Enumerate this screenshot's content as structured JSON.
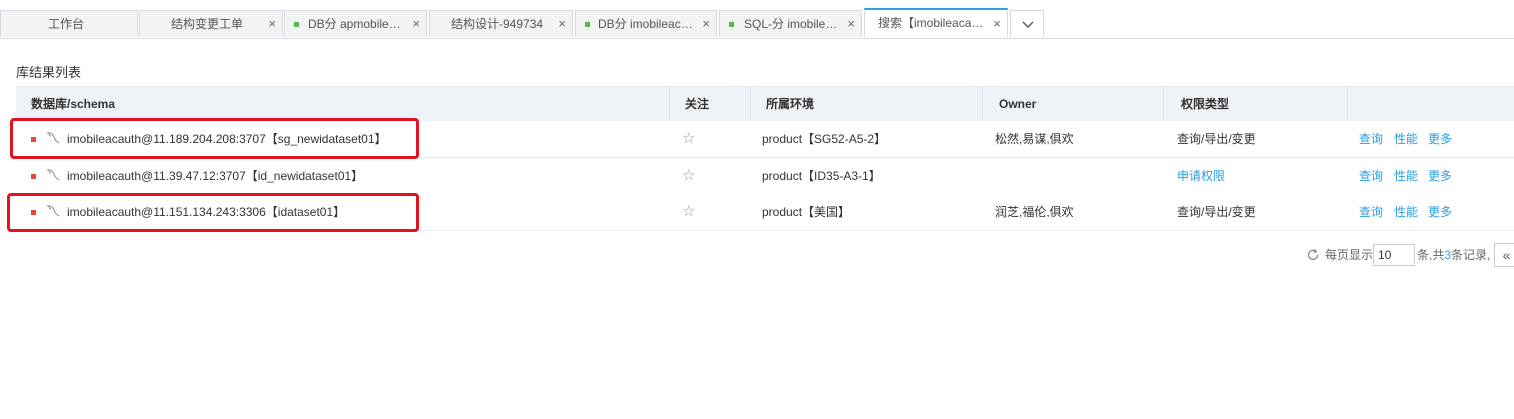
{
  "tabs": [
    {
      "label": "工作台",
      "closable": false,
      "dot": false
    },
    {
      "label": "结构变更工单",
      "closable": true,
      "dot": false
    },
    {
      "label": "DB分 apmobile…",
      "closable": true,
      "dot": true
    },
    {
      "label": "结构设计-949734",
      "closable": true,
      "dot": false
    },
    {
      "label": "DB分 imobileac…",
      "closable": true,
      "dot": true
    },
    {
      "label": "SQL-分 imobile…",
      "closable": true,
      "dot": true
    },
    {
      "label": "搜索【imobileaca…",
      "closable": true,
      "dot": false,
      "active": true
    }
  ],
  "tab_close_glyph": "×",
  "section_title": "库结果列表",
  "table": {
    "headers": {
      "db": "数据库/schema",
      "follow": "关注",
      "env": "所属环境",
      "owner": "Owner",
      "perm": "权限类型"
    },
    "rows": [
      {
        "db": "imobileacauth@11.189.204.208:3707【sg_newidataset01】",
        "env": "product【SG52-A5-2】",
        "owner": "松然,易谋,俱欢",
        "perm": "查询/导出/变更",
        "perm_is_link": false
      },
      {
        "db": "imobileacauth@11.39.47.12:3707【id_newidataset01】",
        "env": "product【ID35-A3-1】",
        "owner": "",
        "perm": "申请权限",
        "perm_is_link": true
      },
      {
        "db": "imobileacauth@11.151.134.243:3306【idataset01】",
        "env": "product【美国】",
        "owner": "润芝,福伦,俱欢",
        "perm": "查询/导出/变更",
        "perm_is_link": false
      }
    ],
    "actions": {
      "query": "查询",
      "perf": "性能",
      "more": "更多"
    },
    "star_glyph": "☆"
  },
  "pagination": {
    "per_page_label": "每页显示",
    "per_page_value": "10",
    "total_prefix": "条,共",
    "total_count": "3",
    "total_suffix": "条记录,",
    "first_glyph": "«"
  },
  "colors": {
    "accent": "#2b9fe0",
    "highlight": "#e0141e",
    "status_dot": "#e8473b",
    "tab_dot": "#52b947"
  }
}
